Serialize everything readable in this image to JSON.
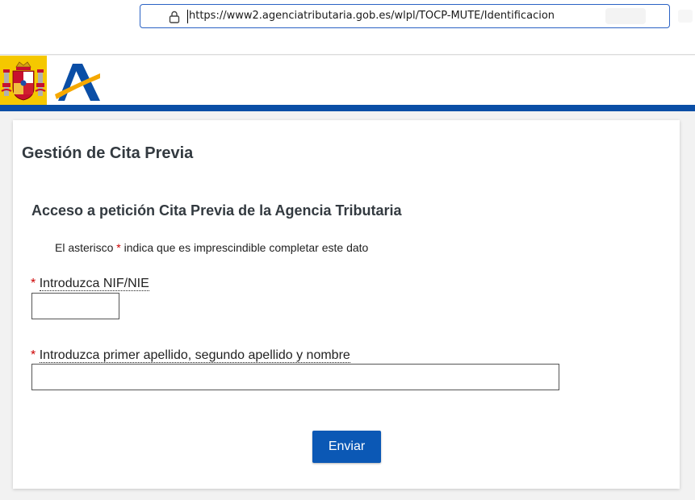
{
  "browser": {
    "url": "https://www2.agenciatributaria.gob.es/wlpl/TOCP-MUTE/Identificacion",
    "lock_icon": "lock-icon"
  },
  "header": {
    "escudo_icon": "spain-coat-of-arms-icon",
    "logo_icon": "agencia-tributaria-logo-icon",
    "band_color": "#0a4ea6"
  },
  "page": {
    "title": "Gestión de Cita Previa",
    "section_title": "Acceso a petición Cita Previa de la Agencia Tributaria",
    "note_before": "El asterisco ",
    "note_asterisk": "*",
    "note_after": " indica que es imprescindible completar este dato"
  },
  "form": {
    "nif": {
      "required_mark": "*",
      "label": "Introduzca NIF/NIE",
      "value": ""
    },
    "name": {
      "required_mark": "*",
      "label": "Introduzca primer apellido, segundo apellido y nombre",
      "value": ""
    },
    "submit_label": "Enviar",
    "button_color": "#0b58b5"
  }
}
